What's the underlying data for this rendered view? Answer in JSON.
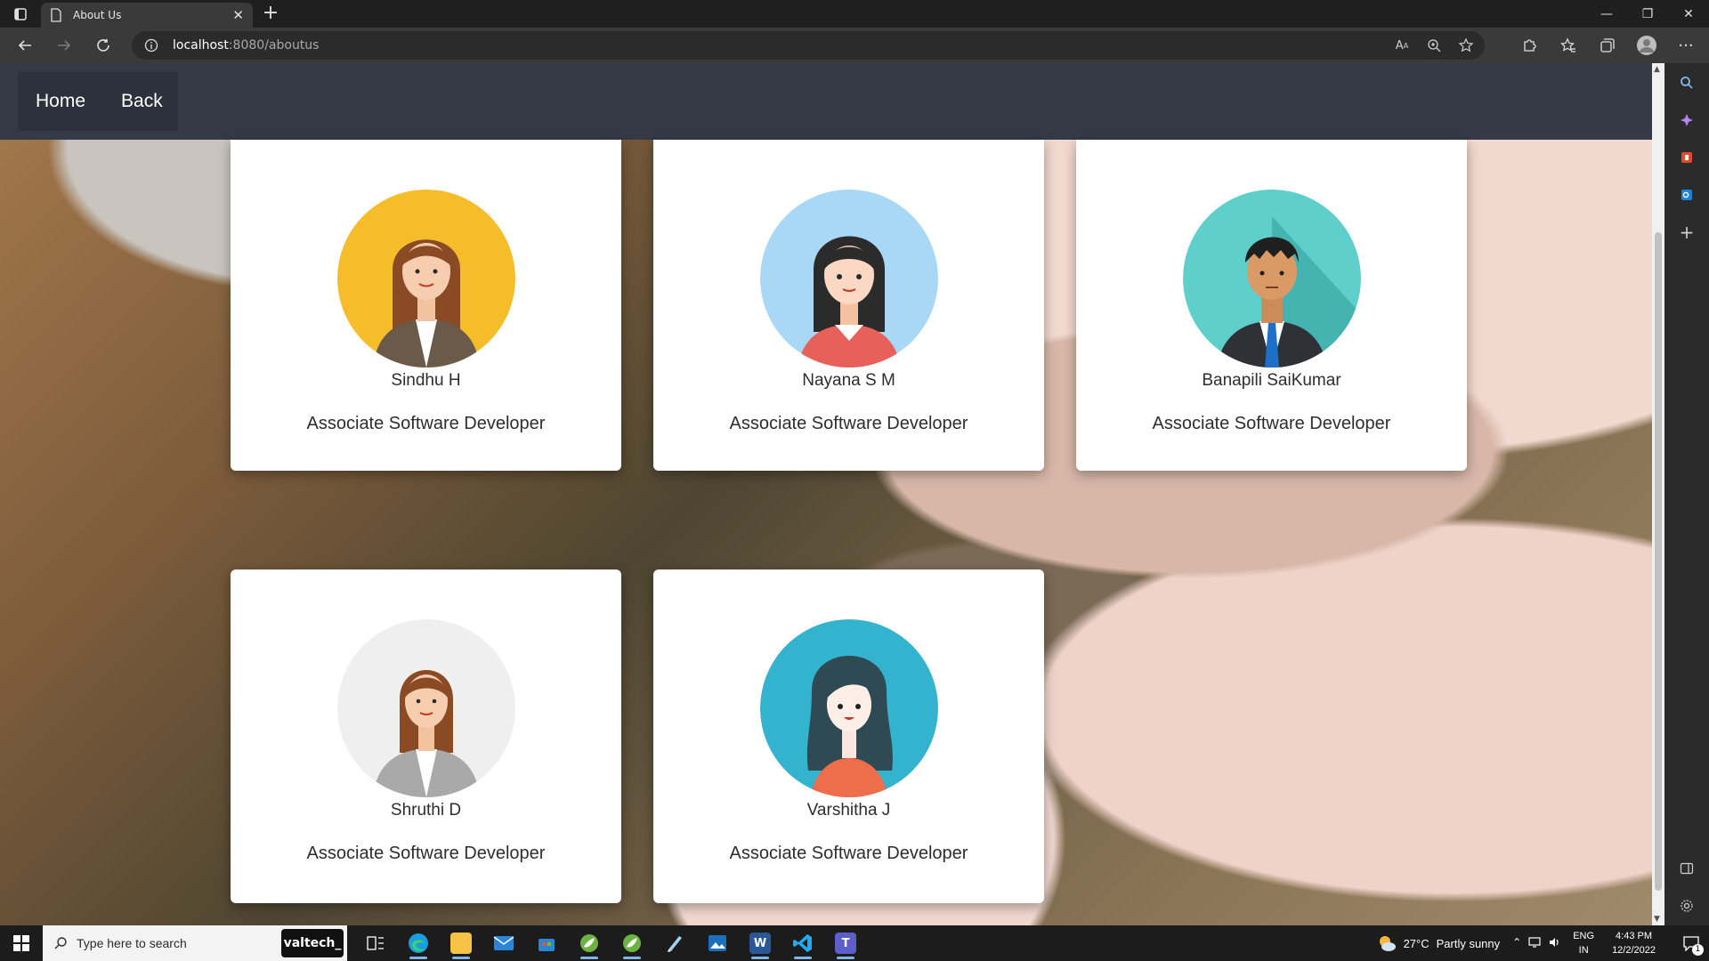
{
  "browser": {
    "tab_title": "About Us",
    "url_host": "localhost",
    "url_rest": ":8080/aboutus"
  },
  "site_nav": {
    "home_label": "Home",
    "back_label": "Back"
  },
  "team": [
    {
      "name": "Sindhu H",
      "role": "Associate Software Developer",
      "avatar_color": "#f6bd2a"
    },
    {
      "name": "Nayana S M",
      "role": "Associate Software Developer",
      "avatar_color": "#a8d8f5"
    },
    {
      "name": "Banapili SaiKumar",
      "role": "Associate Software Developer",
      "avatar_color": "#5ecfcb"
    },
    {
      "name": "Shruthi D",
      "role": "Associate Software Developer",
      "avatar_color": "#efefef"
    },
    {
      "name": "Varshitha J",
      "role": "Associate Software Developer",
      "avatar_color": "#34b3ce"
    }
  ],
  "taskbar": {
    "search_placeholder": "Type here to search",
    "badge_label": "valtech_",
    "weather_temp": "27°C",
    "weather_text": "Partly sunny",
    "lang_line1": "ENG",
    "lang_line2": "IN",
    "time": "4:43 PM",
    "date": "12/2/2022",
    "notification_count": "1"
  }
}
